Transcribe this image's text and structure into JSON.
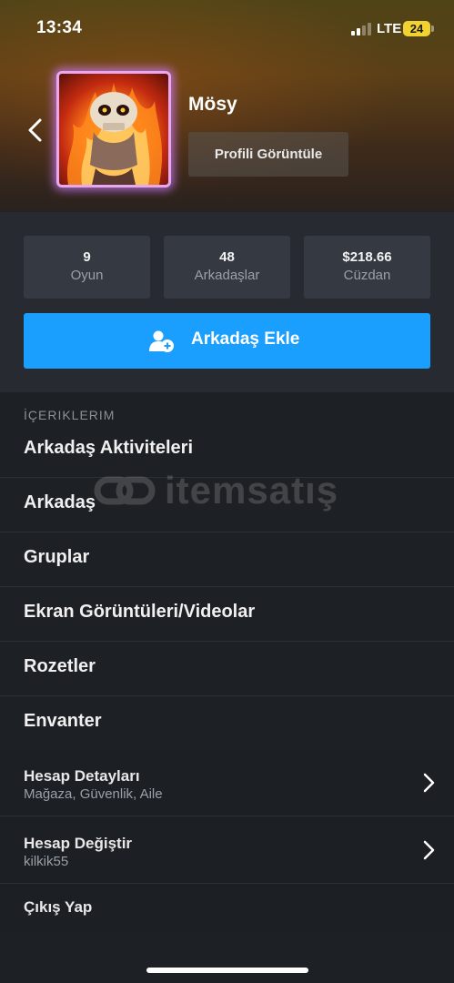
{
  "status_bar": {
    "time": "13:34",
    "network": "LTE",
    "battery": "24"
  },
  "profile": {
    "username": "Mösy",
    "view_profile_label": "Profili Görüntüle",
    "avatar_icon": "flaming-skull-avatar",
    "frame_color": "#e8a8f0"
  },
  "stats": [
    {
      "value": "9",
      "label": "Oyun"
    },
    {
      "value": "48",
      "label": "Arkadaşlar"
    },
    {
      "value": "$218.66",
      "label": "Cüzdan"
    }
  ],
  "add_friend": {
    "label": "Arkadaş Ekle",
    "icon": "add-user-icon",
    "color": "#1a9fff"
  },
  "content_section": {
    "title": "İÇERIKLERIM",
    "items": [
      "Arkadaş Aktiviteleri",
      "Arkadaş",
      "Gruplar",
      "Ekran Görüntüleri/Videolar",
      "Rozetler",
      "Envanter"
    ]
  },
  "account": {
    "details_title": "Hesap Detayları",
    "details_subtitle": "Mağaza, Güvenlik, Aile",
    "switch_title": "Hesap Değiştir",
    "switch_subtitle": "kilkik55",
    "logout_label": "Çıkış Yap"
  },
  "watermark": {
    "text": "itemsatış"
  }
}
